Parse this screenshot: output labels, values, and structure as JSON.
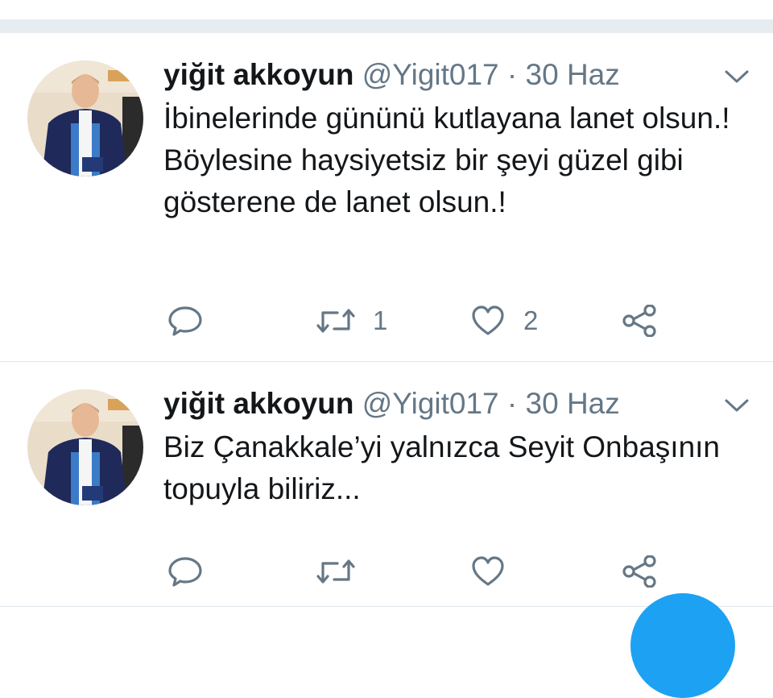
{
  "tweets": [
    {
      "name": "yiğit akkoyun",
      "handle": "@Yigit017",
      "separator": "·",
      "date": "30 Haz",
      "text_lines": [
        "İbinelerinde gününü kutlayana lanet olsun.!",
        "Böylesine haysiyetsiz bir şeyi güzel gibi gösterene de lanet olsun.!"
      ],
      "retweet_count": "1",
      "like_count": "2"
    },
    {
      "name": "yiğit akkoyun",
      "handle": "@Yigit017",
      "separator": "·",
      "date": "30 Haz",
      "text_lines": [
        "Biz Çanakkale’yi yalnızca Seyit Onbaşının topuyla biliriz..."
      ],
      "retweet_count": "",
      "like_count": ""
    }
  ],
  "icons": {
    "reply": "reply-icon",
    "retweet": "retweet-icon",
    "like": "heart-icon",
    "share": "share-icon",
    "caret": "chevron-down-icon"
  },
  "colors": {
    "text": "#14171a",
    "secondary": "#657786",
    "divider": "#e6ecf0",
    "accent": "#1da1f2"
  }
}
